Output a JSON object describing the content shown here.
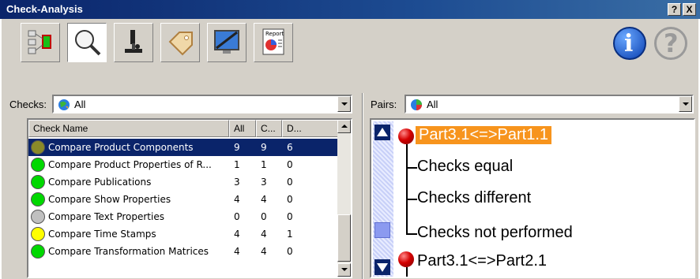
{
  "window": {
    "title": "Check-Analysis",
    "help_button": "?",
    "close_button": "X"
  },
  "toolbar": {
    "tools": [
      {
        "name": "structure-tool",
        "icon": "product-structure-icon"
      },
      {
        "name": "zoom-tool",
        "icon": "magnifier-icon"
      },
      {
        "name": "microscope-tool",
        "icon": "microscope-icon"
      },
      {
        "name": "tag-tool",
        "icon": "tag-icon"
      },
      {
        "name": "display-tool",
        "icon": "monitor-icon"
      },
      {
        "name": "report-tool",
        "icon": "report-icon",
        "caption": "Report"
      }
    ],
    "info_icon": "info-icon",
    "help_icon": "help-icon"
  },
  "checks": {
    "label": "Checks:",
    "selected": "All",
    "columns": [
      "Check Name",
      "All",
      "C...",
      "D..."
    ],
    "rows": [
      {
        "name": "Compare Product Components",
        "all": "9",
        "c": "9",
        "d": "6",
        "status": "olive",
        "selected": true
      },
      {
        "name": "Compare Product Properties of R...",
        "all": "1",
        "c": "1",
        "d": "0",
        "status": "green"
      },
      {
        "name": "Compare Publications",
        "all": "3",
        "c": "3",
        "d": "0",
        "status": "green"
      },
      {
        "name": "Compare Show Properties",
        "all": "4",
        "c": "4",
        "d": "0",
        "status": "green"
      },
      {
        "name": "Compare Text Properties",
        "all": "0",
        "c": "0",
        "d": "0",
        "status": "gray"
      },
      {
        "name": "Compare Time Stamps",
        "all": "4",
        "c": "4",
        "d": "1",
        "status": "yellow"
      },
      {
        "name": "Compare Transformation Matrices",
        "all": "4",
        "c": "4",
        "d": "0",
        "status": "green"
      }
    ]
  },
  "pairs": {
    "label": "Pairs:",
    "selected": "All",
    "tree": {
      "root": "Part3.1<=>Part1.1",
      "children": [
        "Checks equal",
        "Checks different",
        "Checks not performed"
      ],
      "next": "Part3.1<=>Part2.1"
    }
  },
  "colors": {
    "title_bar": "#0a246a",
    "selection": "#0a246a",
    "tree_selection": "#f7941d",
    "status_green": "#00d800",
    "status_olive": "#8a8a28",
    "status_yellow": "#ffff00",
    "status_gray": "#c0c0c0"
  }
}
